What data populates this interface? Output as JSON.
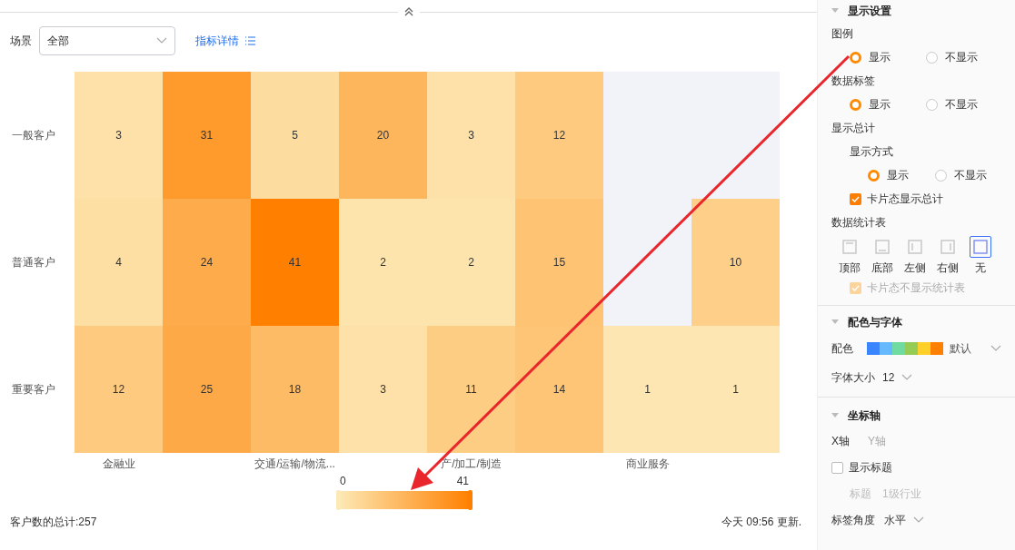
{
  "toolbar": {
    "filter_label": "场景",
    "filter_value": "全部",
    "details_link": "指标详情"
  },
  "heatmap": {
    "rows": [
      {
        "label": "一般客户",
        "cells": [
          {
            "kind": "value",
            "value": "3"
          },
          {
            "kind": "value",
            "value": "31"
          },
          {
            "kind": "value",
            "value": "5"
          },
          {
            "kind": "value",
            "value": "20"
          },
          {
            "kind": "value",
            "value": "3"
          },
          {
            "kind": "value",
            "value": "12"
          },
          {
            "kind": "empty"
          },
          {
            "kind": "empty"
          }
        ]
      },
      {
        "label": "普通客户",
        "cells": [
          {
            "kind": "value",
            "value": "4"
          },
          {
            "kind": "value",
            "value": "24"
          },
          {
            "kind": "value",
            "value": "41"
          },
          {
            "kind": "value",
            "value": "2"
          },
          {
            "kind": "value",
            "value": "2"
          },
          {
            "kind": "value",
            "value": "15"
          },
          {
            "kind": "empty"
          },
          {
            "kind": "value",
            "value": "10"
          }
        ]
      },
      {
        "label": "重要客户",
        "cells": [
          {
            "kind": "value",
            "value": "12"
          },
          {
            "kind": "value",
            "value": "25"
          },
          {
            "kind": "value",
            "value": "18"
          },
          {
            "kind": "value",
            "value": "3"
          },
          {
            "kind": "value",
            "value": "11"
          },
          {
            "kind": "value",
            "value": "14"
          },
          {
            "kind": "value",
            "value": "1"
          },
          {
            "kind": "value",
            "value": "1"
          }
        ]
      }
    ],
    "x_axis": [
      "金融业",
      "交通/运输/物流...",
      "产/加工/制造",
      "商业服务"
    ]
  },
  "legend": {
    "min": "0",
    "max": "41"
  },
  "footer": {
    "total": "客户数的总计:257",
    "updated": "今天 09:56 更新."
  },
  "display_settings": {
    "title": "显示设置",
    "expanded": true,
    "legend": {
      "label": "图例",
      "options": [
        {
          "label": "显示",
          "selected": true
        },
        {
          "label": "不显示",
          "selected": false
        }
      ]
    },
    "data_labels": {
      "label": "数据标签",
      "options": [
        {
          "label": "显示",
          "selected": true
        },
        {
          "label": "不显示",
          "selected": false
        }
      ]
    },
    "total": {
      "label": "显示总计",
      "mode_label": "显示方式",
      "options": [
        {
          "label": "显示",
          "selected": true
        },
        {
          "label": "不显示",
          "selected": false
        }
      ],
      "card_total": {
        "label": "卡片态显示总计",
        "checked": true
      }
    },
    "stats_table": {
      "label": "数据统计表",
      "positions": [
        {
          "kind": "top",
          "label": "顶部",
          "selected": false
        },
        {
          "kind": "bottom",
          "label": "底部",
          "selected": false
        },
        {
          "kind": "left",
          "label": "左侧",
          "selected": false
        },
        {
          "kind": "right",
          "label": "右侧",
          "selected": false
        },
        {
          "kind": "none",
          "label": "无",
          "selected": true
        }
      ],
      "card_hide": {
        "label": "卡片态不显示统计表",
        "checked": true,
        "disabled": true
      }
    }
  },
  "color_font": {
    "title": "配色与字体",
    "expanded": true,
    "palette_label": "配色",
    "palette": [
      {
        "color": "#3a84ff"
      },
      {
        "color": "#66b8ff"
      },
      {
        "color": "#6fdba0"
      },
      {
        "color": "#95cc55"
      },
      {
        "color": "#ffd02a"
      },
      {
        "color": "#ff8000"
      }
    ],
    "palette_name": "默认",
    "font_size_label": "字体大小",
    "font_size": "12"
  },
  "axis": {
    "title": "坐标轴",
    "expanded": true,
    "tabs": [
      {
        "label": "X轴",
        "selected": true
      },
      {
        "label": "Y轴",
        "selected": false
      }
    ],
    "show_title": {
      "label": "显示标题",
      "checked": false
    },
    "title_label": "标题",
    "title_value": "1级行业",
    "label_angle_label": "标签角度",
    "label_angle": "水平"
  }
}
